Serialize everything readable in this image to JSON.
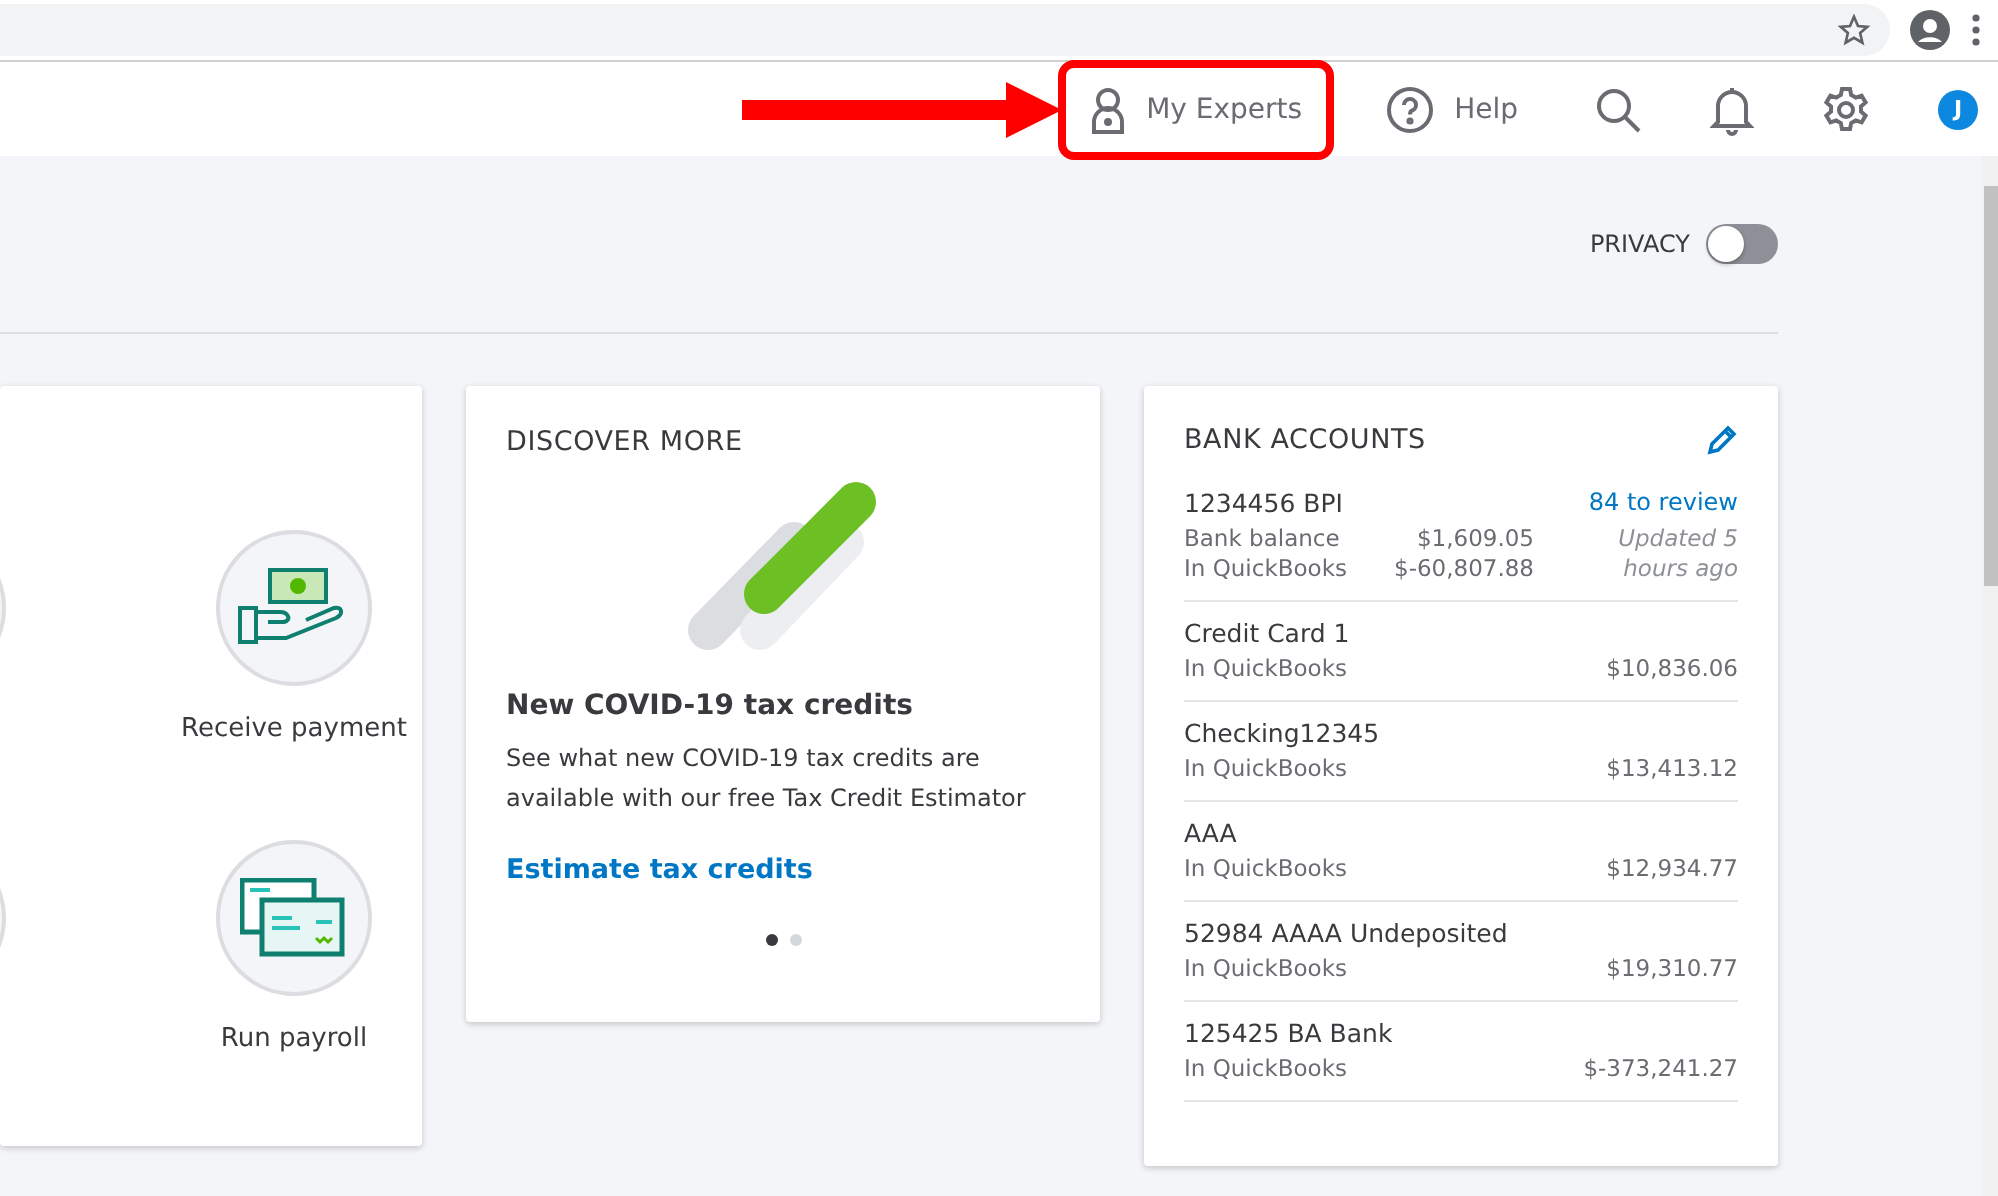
{
  "header": {
    "items": [
      {
        "kind": "experts",
        "label": "My Experts",
        "highlighted": true
      },
      {
        "kind": "help",
        "label": "Help",
        "highlighted": false
      },
      {
        "kind": "search"
      },
      {
        "kind": "bell"
      },
      {
        "kind": "gear"
      }
    ],
    "user_initial": "J"
  },
  "privacy": {
    "label": "PRIVACY",
    "on": false
  },
  "shortcuts": [
    {
      "kind": "receive",
      "label": "Receive payment"
    },
    {
      "kind": "payroll",
      "label": "Run payroll"
    }
  ],
  "discover": {
    "title": "DISCOVER MORE",
    "headline": "New COVID-19 tax credits",
    "body": "See what new COVID-19 tax credits are available with our free Tax Credit Estimator",
    "link": "Estimate tax credits",
    "dots": [
      {
        "selected": true
      },
      {
        "selected": false
      }
    ]
  },
  "bank_accounts": {
    "title": "BANK ACCOUNTS",
    "accounts": [
      {
        "kind": "detailed",
        "name": "1234456 BPI",
        "review": "84 to review",
        "bank_label": "Bank balance",
        "bank_amount": "$1,609.05",
        "qb_label": "In QuickBooks",
        "qb_amount": "$-60,807.88",
        "updated": "Updated 5 hours ago"
      },
      {
        "kind": "simple",
        "name": "Credit Card 1",
        "qb_label": "In QuickBooks",
        "qb_amount": "$10,836.06"
      },
      {
        "kind": "simple",
        "name": "Checking12345",
        "qb_label": "In QuickBooks",
        "qb_amount": "$13,413.12"
      },
      {
        "kind": "simple",
        "name": "AAA",
        "qb_label": "In QuickBooks",
        "qb_amount": "$12,934.77"
      },
      {
        "kind": "simple",
        "name": "52984 AAAA Undeposited",
        "qb_label": "In QuickBooks",
        "qb_amount": "$19,310.77"
      },
      {
        "kind": "simple",
        "name": "125425 BA Bank",
        "qb_label": "In QuickBooks",
        "qb_amount": "$-373,241.27"
      }
    ]
  }
}
